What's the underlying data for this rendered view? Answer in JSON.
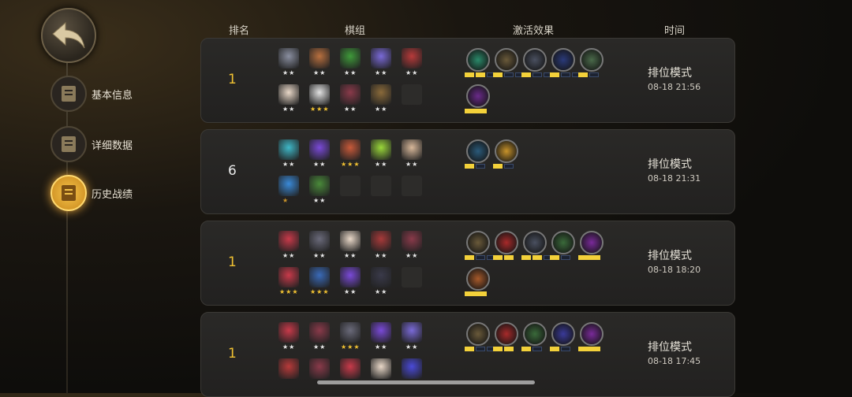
{
  "nav": {
    "back": "back",
    "items": [
      {
        "label": "基本信息",
        "icon": "clipboard-icon",
        "active": false
      },
      {
        "label": "详细数据",
        "icon": "stats-doc-icon",
        "active": false
      },
      {
        "label": "历史战绩",
        "icon": "history-icon",
        "active": true
      }
    ]
  },
  "columns": {
    "rank": "排名",
    "team": "棋组",
    "traits": "激活效果",
    "time": "时间"
  },
  "matches": [
    {
      "rank": "1",
      "rank_color": "#f1c232",
      "mode": "排位模式",
      "time": "08-18 21:56",
      "units": [
        {
          "color": "#8a8fa0",
          "stars": "★★",
          "star_color": "#e9e9e9"
        },
        {
          "color": "#b9703f",
          "stars": "★★",
          "star_color": "#e9e9e9"
        },
        {
          "color": "#3f9a3a",
          "stars": "★★",
          "star_color": "#e9e9e9"
        },
        {
          "color": "#7a6ad8",
          "stars": "★★",
          "star_color": "#e9e9e9"
        },
        {
          "color": "#b83a3a",
          "stars": "★★",
          "star_color": "#e9e9e9"
        },
        {
          "color": "#e9d8c8",
          "stars": "★★",
          "star_color": "#e9e9e9"
        },
        {
          "color": "#e2e2e2",
          "stars": "★★★",
          "star_color": "#f1c232"
        },
        {
          "color": "#8a3a4a",
          "stars": "★★",
          "star_color": "#e9e9e9"
        },
        {
          "color": "#8a6a3a",
          "stars": "★★",
          "star_color": "#e9e9e9"
        },
        {
          "color": "",
          "stars": "",
          "star_color": ""
        }
      ],
      "traits": [
        {
          "color": "#2a8a6a",
          "icon": "paw-icon",
          "bar": [
            1,
            1,
            0
          ]
        },
        {
          "color": "#6a5a3a",
          "icon": "axe-icon",
          "bar": [
            1,
            0,
            0
          ]
        },
        {
          "color": "#4a5060",
          "icon": "helmet-icon",
          "bar": [
            1,
            0,
            0
          ]
        },
        {
          "color": "#2a3a7a",
          "icon": "mask-icon",
          "bar": [
            1,
            0,
            0
          ]
        },
        {
          "color": "#4a6a4a",
          "icon": "druid-icon",
          "bar": [
            1,
            0
          ]
        },
        {
          "color": "#6a2a8a",
          "icon": "demon-icon",
          "bar": [
            1
          ]
        }
      ]
    },
    {
      "rank": "6",
      "rank_color": "#e9e9e9",
      "mode": "排位模式",
      "time": "08-18 21:31",
      "units": [
        {
          "color": "#3fb8c8",
          "stars": "★★",
          "star_color": "#e9e9e9"
        },
        {
          "color": "#7a4ad8",
          "stars": "★★",
          "star_color": "#e9e9e9"
        },
        {
          "color": "#c85a3a",
          "stars": "★★★",
          "star_color": "#f1c232"
        },
        {
          "color": "#9ad83a",
          "stars": "★★",
          "star_color": "#e9e9e9"
        },
        {
          "color": "#d8b89a",
          "stars": "★★",
          "star_color": "#e9e9e9"
        },
        {
          "color": "#3a8ad8",
          "stars": "★",
          "star_color": "#c8932a"
        },
        {
          "color": "#4a8a3a",
          "stars": "★★",
          "star_color": "#e9e9e9"
        },
        {
          "color": "",
          "stars": "",
          "star_color": ""
        },
        {
          "color": "",
          "stars": "",
          "star_color": ""
        },
        {
          "color": "",
          "stars": "",
          "star_color": ""
        }
      ],
      "traits": [
        {
          "color": "#2a5a7a",
          "icon": "question-icon",
          "bar": [
            1,
            0
          ]
        },
        {
          "color": "#c8932a",
          "icon": "goblin-icon",
          "bar": [
            1,
            0
          ]
        }
      ]
    },
    {
      "rank": "1",
      "rank_color": "#f1c232",
      "mode": "排位模式",
      "time": "08-18 18:20",
      "units": [
        {
          "color": "#c83a4a",
          "stars": "★★",
          "star_color": "#e9e9e9"
        },
        {
          "color": "#6a6a7a",
          "stars": "★★",
          "star_color": "#e9e9e9"
        },
        {
          "color": "#e9d8c8",
          "stars": "★★",
          "star_color": "#e9e9e9"
        },
        {
          "color": "#a83a3a",
          "stars": "★★",
          "star_color": "#e9e9e9"
        },
        {
          "color": "#8a3a4a",
          "stars": "★★",
          "star_color": "#e9e9e9"
        },
        {
          "color": "#c83a4a",
          "stars": "★★★",
          "star_color": "#f1c232"
        },
        {
          "color": "#3a6ab8",
          "stars": "★★★",
          "star_color": "#f1c232"
        },
        {
          "color": "#7a4ad8",
          "stars": "★★",
          "star_color": "#e9e9e9"
        },
        {
          "color": "#3a3a4a",
          "stars": "★★",
          "star_color": "#e9e9e9"
        },
        {
          "color": "",
          "stars": "",
          "star_color": ""
        }
      ],
      "traits": [
        {
          "color": "#6a5a3a",
          "icon": "axe-icon",
          "bar": [
            1,
            0,
            0
          ]
        },
        {
          "color": "#a82a2a",
          "icon": "arc-icon",
          "bar": [
            1,
            1
          ]
        },
        {
          "color": "#4a5060",
          "icon": "claw-icon",
          "bar": [
            1,
            1,
            0
          ]
        },
        {
          "color": "#3a6a3a",
          "icon": "crossbow-icon",
          "bar": [
            1,
            0
          ]
        },
        {
          "color": "#7a2a9a",
          "icon": "demon-icon",
          "bar": [
            1
          ]
        },
        {
          "color": "#a85a2a",
          "icon": "beast-icon",
          "bar": [
            1
          ]
        }
      ]
    },
    {
      "rank": "1",
      "rank_color": "#f1c232",
      "mode": "排位模式",
      "time": "08-18 17:45",
      "units": [
        {
          "color": "#c83a4a",
          "stars": "★★",
          "star_color": "#e9e9e9"
        },
        {
          "color": "#8a3a4a",
          "stars": "★★",
          "star_color": "#e9e9e9"
        },
        {
          "color": "#6a6a7a",
          "stars": "★★★",
          "star_color": "#f1c232"
        },
        {
          "color": "#7a4ad8",
          "stars": "★★",
          "star_color": "#e9e9e9"
        },
        {
          "color": "#7a6ad8",
          "stars": "★★",
          "star_color": "#e9e9e9"
        },
        {
          "color": "#b83a3a",
          "stars": "",
          "star_color": ""
        },
        {
          "color": "#8a3a4a",
          "stars": "",
          "star_color": ""
        },
        {
          "color": "#c83a4a",
          "stars": "",
          "star_color": ""
        },
        {
          "color": "#e9d8c8",
          "stars": "",
          "star_color": ""
        },
        {
          "color": "#4a4ad8",
          "stars": "",
          "star_color": ""
        }
      ],
      "traits": [
        {
          "color": "#6a5a3a",
          "icon": "axe-icon",
          "bar": [
            1,
            0,
            0
          ]
        },
        {
          "color": "#a82a2a",
          "icon": "arc-icon",
          "bar": [
            1,
            1
          ]
        },
        {
          "color": "#3a6a3a",
          "icon": "crossbow-icon",
          "bar": [
            1,
            0
          ]
        },
        {
          "color": "#3a3a9a",
          "icon": "fish-icon",
          "bar": [
            1,
            0
          ]
        },
        {
          "color": "#7a2a9a",
          "icon": "demon-icon",
          "bar": [
            1
          ]
        }
      ]
    }
  ]
}
